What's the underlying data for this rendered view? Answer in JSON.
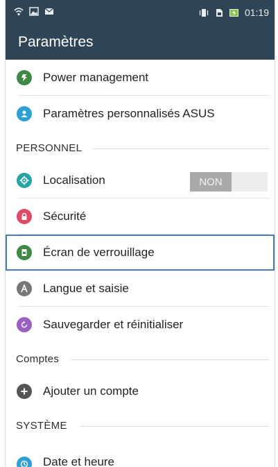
{
  "status_bar": {
    "time": "01:19",
    "icons_left": [
      "wifi-icon",
      "image-notification-icon",
      "mail-notification-icon"
    ],
    "icons_right": [
      "vibrate-icon",
      "sim-icon",
      "battery-charging-icon"
    ]
  },
  "app_bar": {
    "title": "Paramètres"
  },
  "colors": {
    "header": "#2f4556",
    "power": "#3e8a45",
    "asus": "#2c9fd6",
    "location": "#26a3a3",
    "security": "#e04a64",
    "lock": "#3e8a45",
    "language": "#777777",
    "backup": "#9a5fc4",
    "account": "#555555",
    "datetime": "#2c9fd6",
    "selection": "#4a7cb0"
  },
  "items": {
    "power": {
      "label": "Power management",
      "icon": "power-icon"
    },
    "asus": {
      "label": "Paramètres personnalisés ASUS",
      "icon": "asus-settings-icon"
    },
    "location": {
      "label": "Localisation",
      "icon": "location-icon",
      "toggle": "NON"
    },
    "security": {
      "label": "Sécurité",
      "icon": "lock-icon"
    },
    "lockscreen": {
      "label": "Écran de verrouillage",
      "icon": "lock-screen-icon"
    },
    "language": {
      "label": "Langue et saisie",
      "icon": "language-icon"
    },
    "backup": {
      "label": "Sauvegarder et réinitialiser",
      "icon": "backup-icon"
    },
    "add_account": {
      "label": "Ajouter un compte",
      "icon": "add-icon"
    },
    "datetime": {
      "label": "Date et heure",
      "icon": "clock-icon"
    }
  },
  "sections": {
    "personnel": "PERSONNEL",
    "comptes": "Comptes",
    "systeme": "SYSTÈME"
  }
}
